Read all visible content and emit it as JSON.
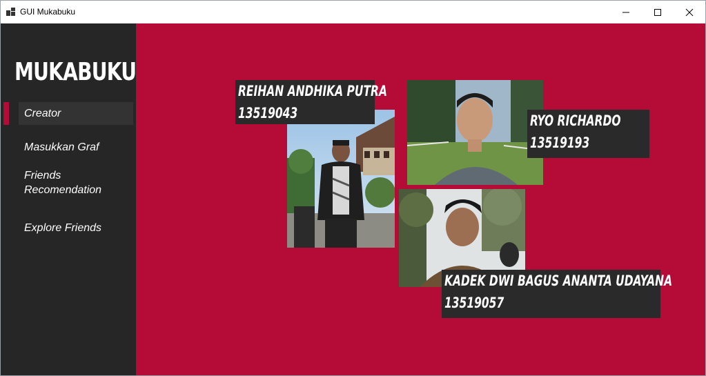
{
  "window": {
    "title": "GUI Mukabuku"
  },
  "sidebar": {
    "logo": "MUKABUKU",
    "items": [
      {
        "label": "Creator"
      },
      {
        "label": "Masukkan Graf"
      },
      {
        "label": "Friends\nRecomendation"
      },
      {
        "label": "Explore Friends"
      }
    ]
  },
  "creators": [
    {
      "name": "REIHAN ANDHIKA PUTRA",
      "nim": "13519043"
    },
    {
      "name": "RYO RICHARDO",
      "nim": "13519193"
    },
    {
      "name": "KADEK DWI BAGUS ANANTA UDAYANA",
      "nim": "13519057"
    }
  ],
  "colors": {
    "accent": "#b50b37",
    "sidebar": "#262626",
    "label_bg": "#2a2a2a"
  }
}
